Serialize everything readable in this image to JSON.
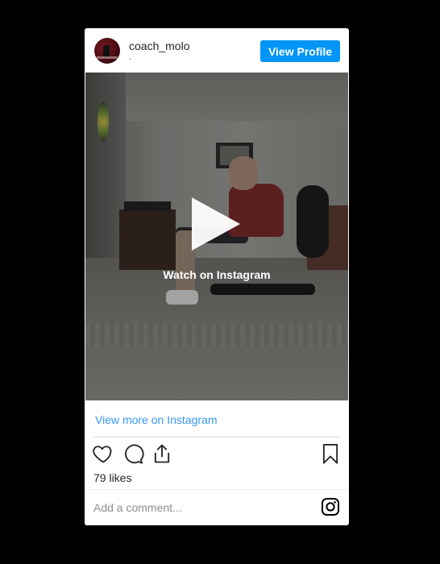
{
  "header": {
    "username": "coach_molo",
    "subtitle": ".",
    "view_profile_label": "View Profile"
  },
  "media": {
    "overlay_label": "Watch on Instagram",
    "play_icon": "play-icon"
  },
  "view_more_label": "View more on Instagram",
  "actions": {
    "like_icon": "heart-icon",
    "comment_icon": "comment-icon",
    "share_icon": "share-icon",
    "save_icon": "bookmark-icon"
  },
  "likes_label": "79 likes",
  "comment_placeholder": "Add a comment...",
  "footer_icon": "instagram-icon",
  "colors": {
    "accent": "#0095f6",
    "link": "#3897f0",
    "page_background": "#000000",
    "card_background": "#ffffff"
  }
}
